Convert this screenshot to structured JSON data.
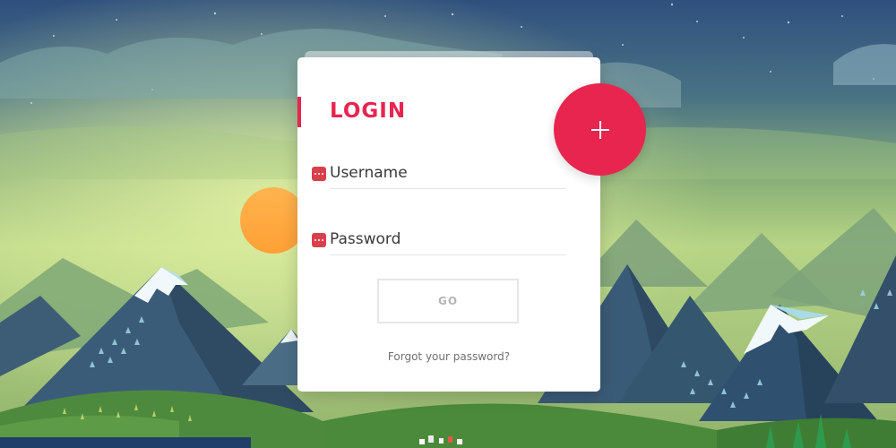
{
  "login": {
    "title": "LOGIN",
    "username": {
      "placeholder": "Username",
      "value": ""
    },
    "password": {
      "placeholder": "Password",
      "value": ""
    },
    "submit_label": "GO",
    "forgot_label": "Forgot your password?"
  },
  "fab": {
    "icon": "plus-icon"
  },
  "colors": {
    "accent": "#e8254f",
    "field_icon": "#d8404b",
    "button_text": "#b5b5b5",
    "sky_top": "#2c4f7d",
    "sky_glow": "#b5d47f",
    "sun": "#ffad47"
  },
  "icons": {
    "username": "password-dots-icon",
    "password": "password-dots-icon"
  }
}
